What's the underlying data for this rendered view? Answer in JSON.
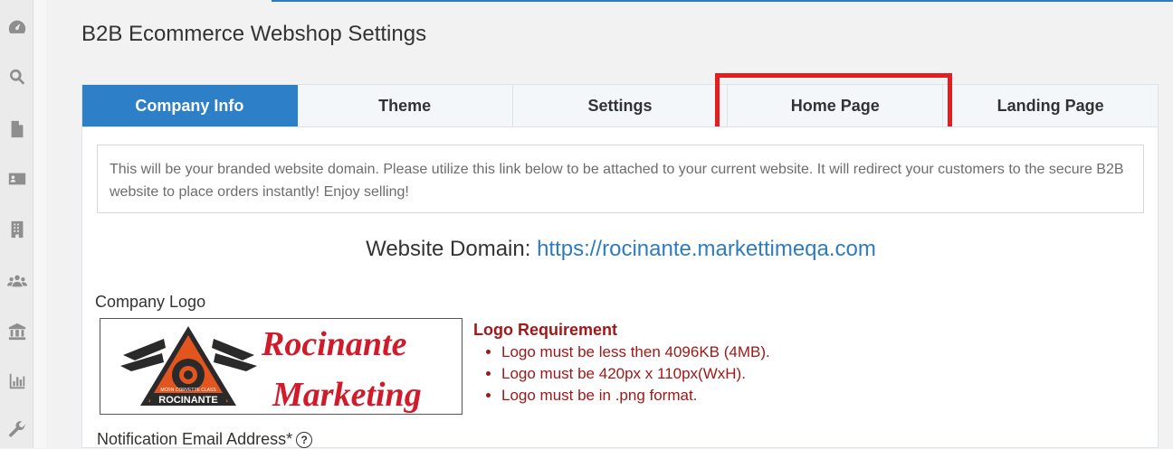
{
  "page": {
    "title": "B2B Ecommerce Webshop Settings"
  },
  "colors": {
    "accent": "#2d7fc8",
    "highlight": "#e41e1e",
    "requirement": "#a01818",
    "link": "#2f7bbf"
  },
  "sidebar": {
    "icons": [
      "dashboard-icon",
      "search-icon",
      "document-icon",
      "contact-card-icon",
      "building-icon",
      "users-icon",
      "bank-icon",
      "bar-chart-icon",
      "wrench-icon"
    ]
  },
  "tabs": [
    {
      "label": "Company Info",
      "active": true
    },
    {
      "label": "Theme",
      "active": false
    },
    {
      "label": "Settings",
      "active": false
    },
    {
      "label": "Home Page",
      "active": false
    },
    {
      "label": "Landing Page",
      "active": false
    }
  ],
  "notice": {
    "text": "This will be your branded website domain. Please utilize this link below to be attached to your current website. It will redirect your customers to the secure B2B website to place orders instantly! Enjoy selling!"
  },
  "domain": {
    "label": "Website Domain:",
    "url": "https://rocinante.markettimeqa.com"
  },
  "logo": {
    "label": "Company Logo",
    "line1": "Rocinante",
    "line2": "Marketing",
    "emblem_text": "ROCINANTE",
    "emblem_subtext": "MCRN CORVETTE CLASS"
  },
  "logo_requirement": {
    "title": "Logo Requirement",
    "items": [
      "Logo must be less then 4096KB (4MB).",
      "Logo must be 420px x 110px(WxH).",
      "Logo must be in .png format."
    ]
  },
  "notification": {
    "label": "Notification Email Address*",
    "help": "?"
  }
}
